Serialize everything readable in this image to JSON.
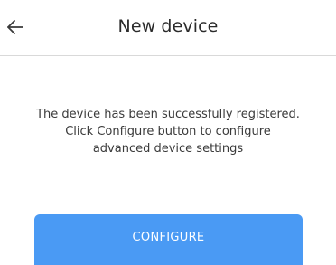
{
  "header": {
    "back_icon": "arrow-left-icon",
    "title": "New device"
  },
  "main": {
    "message_lines": [
      "The device has been successfully registered.",
      "Click Configure button to configure",
      "advanced device settings"
    ],
    "configure_label": "CONFIGURE"
  },
  "colors": {
    "accent": "#4a9af4",
    "divider": "#d9d9d9",
    "text": "#2b2b2b"
  }
}
